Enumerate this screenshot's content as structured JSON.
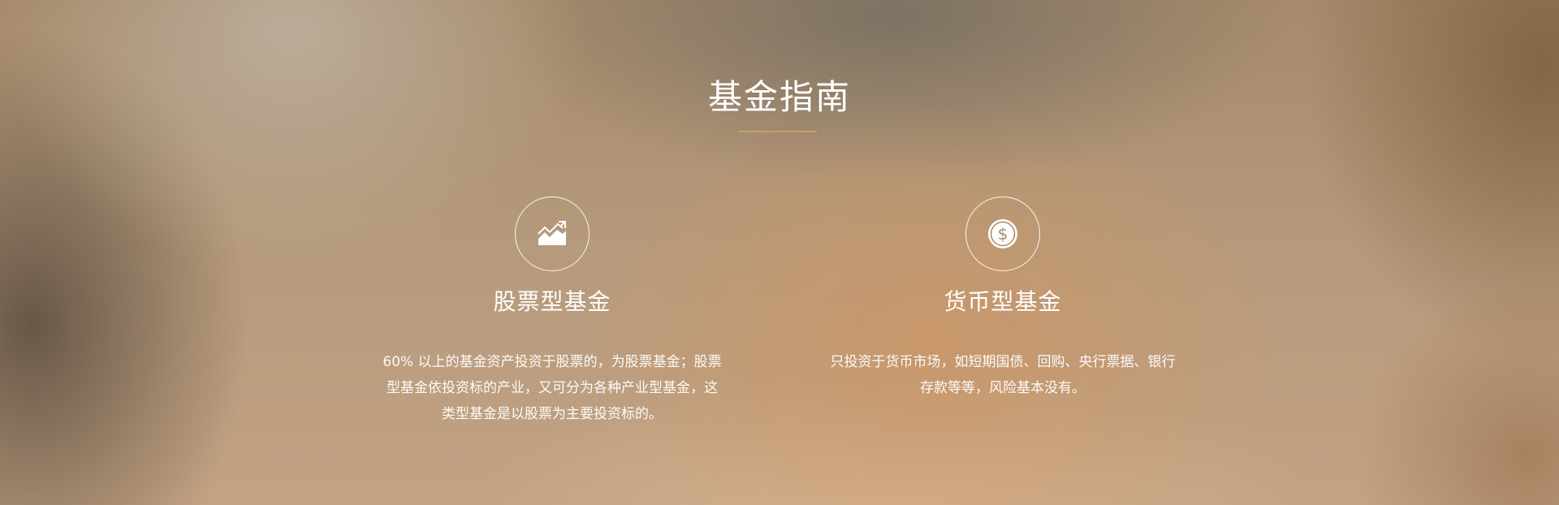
{
  "section": {
    "title": "基金指南",
    "accent_color": "#c9a063"
  },
  "features": [
    {
      "icon": "stock-chart-icon",
      "title": "股票型基金",
      "description": "60% 以上的基金资产投资于股票的，为股票基金；股票型基金依投资标的产业，又可分为各种产业型基金，这类型基金是以股票为主要投资标的。"
    },
    {
      "icon": "dollar-coin-icon",
      "title": "货币型基金",
      "description": "只投资于货币市场，如短期国债、回购、央行票据、银行存款等等，风险基本没有。"
    }
  ]
}
